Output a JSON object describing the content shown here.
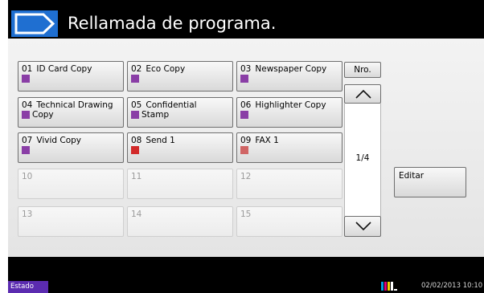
{
  "header": {
    "title": "Rellamada de programa."
  },
  "programs": [
    {
      "num": "01",
      "line1": "ID Card Copy",
      "line2": "",
      "icon": "copy-icon"
    },
    {
      "num": "02",
      "line1": "Eco Copy",
      "line2": "",
      "icon": "copy-icon"
    },
    {
      "num": "03",
      "line1": "Newspaper Copy",
      "line2": "",
      "icon": "copy-icon"
    },
    {
      "num": "04",
      "line1": "Technical Drawing",
      "line2": "Copy",
      "icon": "copy-icon"
    },
    {
      "num": "05",
      "line1": "Confidential",
      "line2": "Stamp",
      "icon": "copy-icon"
    },
    {
      "num": "06",
      "line1": "Highlighter Copy",
      "line2": "",
      "icon": "copy-icon"
    },
    {
      "num": "07",
      "line1": "Vivid Copy",
      "line2": "",
      "icon": "copy-icon"
    },
    {
      "num": "08",
      "line1": "Send 1",
      "line2": "",
      "icon": "send-icon"
    },
    {
      "num": "09",
      "line1": "FAX 1",
      "line2": "",
      "icon": "fax-icon"
    }
  ],
  "empty_slots": [
    "10",
    "11",
    "12",
    "13",
    "14",
    "15"
  ],
  "controls": {
    "nro_label": "Nro.",
    "page_indicator": "1/4",
    "edit_label": "Editar"
  },
  "status_bar": {
    "status_label": "Estado",
    "datetime": "02/02/2013  10:10"
  },
  "colors": {
    "copy_icon": "#8a3ea6",
    "send_icon": "#d22a2a",
    "fax_icon": "#d06565",
    "status_button": "#5b2bb0"
  }
}
